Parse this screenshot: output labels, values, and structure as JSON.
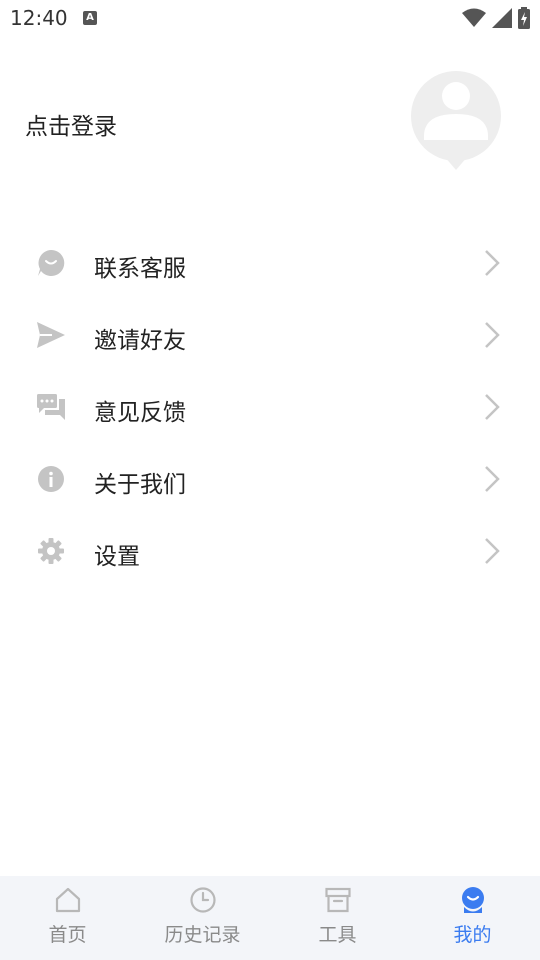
{
  "status_bar": {
    "time": "12:40",
    "notification_icon": "A"
  },
  "profile": {
    "login_label": "点击登录",
    "avatar_icon": "avatar-placeholder-icon"
  },
  "menu": {
    "items": [
      {
        "label": "联系客服",
        "icon": "customer-service-icon"
      },
      {
        "label": "邀请好友",
        "icon": "send-icon"
      },
      {
        "label": "意见反馈",
        "icon": "feedback-icon"
      },
      {
        "label": "关于我们",
        "icon": "info-icon"
      },
      {
        "label": "设置",
        "icon": "gear-icon"
      }
    ]
  },
  "bottom_nav": {
    "items": [
      {
        "label": "首页",
        "icon": "home-icon",
        "active": false
      },
      {
        "label": "历史记录",
        "icon": "clock-icon",
        "active": false
      },
      {
        "label": "工具",
        "icon": "toolbox-icon",
        "active": false
      },
      {
        "label": "我的",
        "icon": "profile-icon",
        "active": true
      }
    ]
  },
  "colors": {
    "accent": "#3b7cf0",
    "icon_gray": "#c4c4c4",
    "nav_background": "#f3f5f9"
  }
}
